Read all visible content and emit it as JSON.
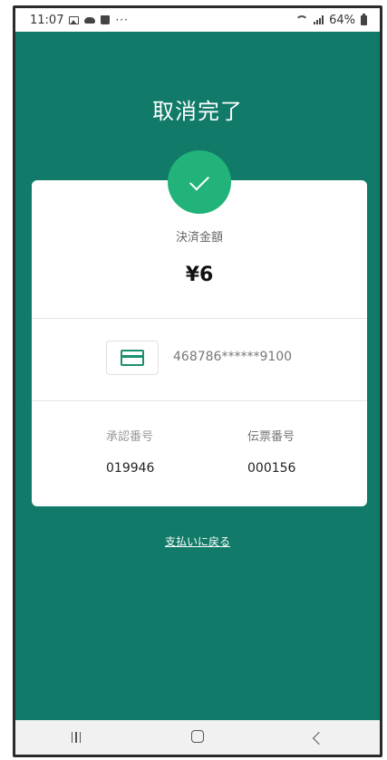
{
  "status_bar": {
    "time": "11:07",
    "overflow": "···",
    "battery": "64%"
  },
  "title": "取消完了",
  "amount": {
    "label": "決済金額",
    "value": "¥6"
  },
  "card": {
    "icon": "credit-card-icon",
    "number": "468786******9100"
  },
  "details": {
    "approval_label": "承認番号",
    "approval_value": "019946",
    "slip_label": "伝票番号",
    "slip_value": "000156"
  },
  "back_link": "支払いに戻る",
  "colors": {
    "background": "#117a68",
    "accent_check": "#21b37a",
    "card_icon": "#1c8f6e"
  }
}
